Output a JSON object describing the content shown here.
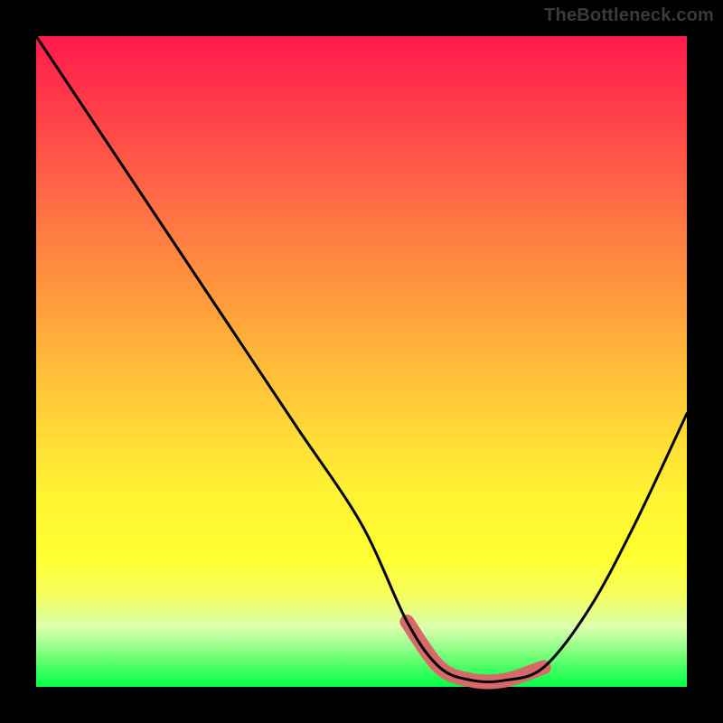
{
  "attribution": "TheBottleneck.com",
  "chart_data": {
    "type": "line",
    "title": "",
    "xlabel": "",
    "ylabel": "",
    "xlim": [
      0,
      100
    ],
    "ylim": [
      0,
      100
    ],
    "series": [
      {
        "name": "curve",
        "color": "#000000",
        "x": [
          0,
          10,
          20,
          30,
          40,
          50,
          57,
          62,
          67,
          72,
          78,
          85,
          92,
          100
        ],
        "y": [
          100,
          85,
          70,
          55,
          40,
          25,
          10,
          3,
          1,
          1,
          3,
          12,
          25,
          42
        ]
      },
      {
        "name": "highlight-band",
        "color": "#d66a6a",
        "x": [
          57,
          62,
          67,
          72,
          78
        ],
        "y": [
          10,
          3,
          1,
          1,
          3
        ]
      }
    ],
    "grid": false,
    "legend": false
  }
}
